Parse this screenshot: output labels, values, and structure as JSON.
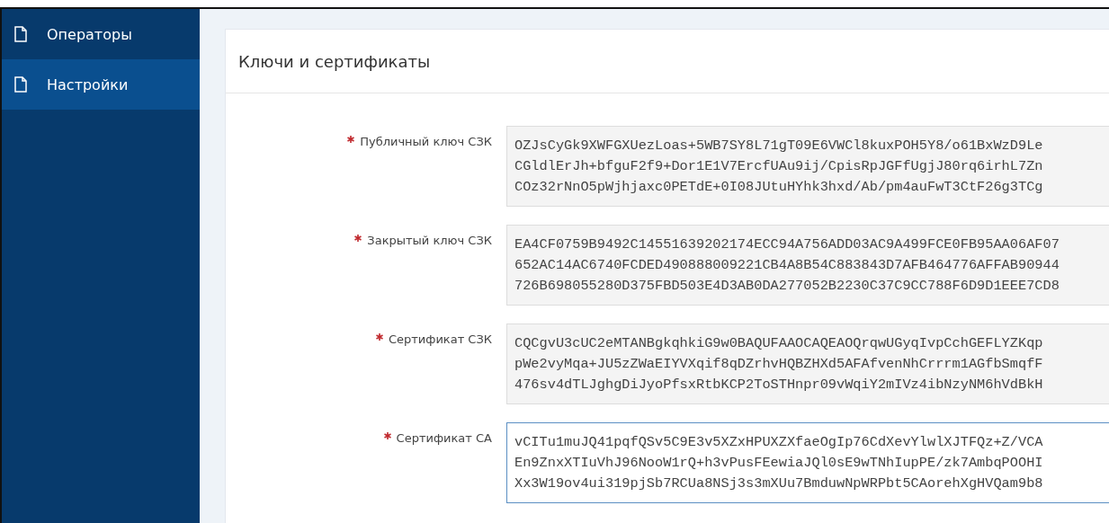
{
  "sidebar": {
    "items": [
      {
        "label": "Операторы",
        "selected": false
      },
      {
        "label": "Настройки",
        "selected": true
      }
    ]
  },
  "card": {
    "title": "Ключи и сертификаты",
    "fields": [
      {
        "label": "Публичный ключ СЗК",
        "required": true,
        "disabled": true,
        "focused": false,
        "value": "OZJsCyGk9XWFGXUezLoas+5WB7SY8L71gT09E6VWCl8kuxPOH5Y8/o61BxWzD9Le\nCGldlErJh+bfguF2f9+Dor1E1V7ErcfUAu9ij/CpisRpJGFfUgjJ80rq6irhL7Zn\nCOz32rNnO5pWjhjaxc0PETdE+0I08JUtuHYhk3hxd/Ab/pm4auFwT3CtF26g3TCg"
      },
      {
        "label": "Закрытый ключ СЗК",
        "required": true,
        "disabled": true,
        "focused": false,
        "value": "EA4CF0759B9492C14551639202174ECC94A756ADD03AC9A499FCE0FB95AA06AF07\n652AC14AC6740FCDED490888009221CB4A8B54C883843D7AFB464776AFFAB90944\n726B698055280D375FBD503E4D3AB0DA277052B2230C37C9CC788F6D9D1EEE7CD8"
      },
      {
        "label": "Сертификат СЗК",
        "required": true,
        "disabled": true,
        "focused": false,
        "value": "CQCgvU3cUC2eMTANBgkqhkiG9w0BAQUFAAOCAQEAOQrqwUGyqIvpCchGEFLYZKqp\npWe2vyMqa+JU5zZWaEIYVXqif8qDZrhvHQBZHXd5AFAfvenNhCrrrm1AGfbSmqfF\n476sv4dTLJghgDiJyoPfsxRtbKCP2ToSTHnpr09vWqiY2mIVz4ibNzyNM6hVdBkH"
      },
      {
        "label": "Сертификат CA",
        "required": true,
        "disabled": false,
        "focused": true,
        "value": "vCITu1muJQ41pqfQSv5C9E3v5XZxHPUXZXfaeOgIp76CdXevYlwlXJTFQz+Z/VCA\nEn9ZnxXTIuVhJ96NooW1rQ+h3vPusFEewiaJQl0sE9wTNhIupPE/zk7AmbqPOOHI\nXx3W19ov4ui319pjSb7RCUa8NSj3s3mXUu7BmduwNpWRPbt5CAorehXgHVQam9b8"
      }
    ]
  }
}
